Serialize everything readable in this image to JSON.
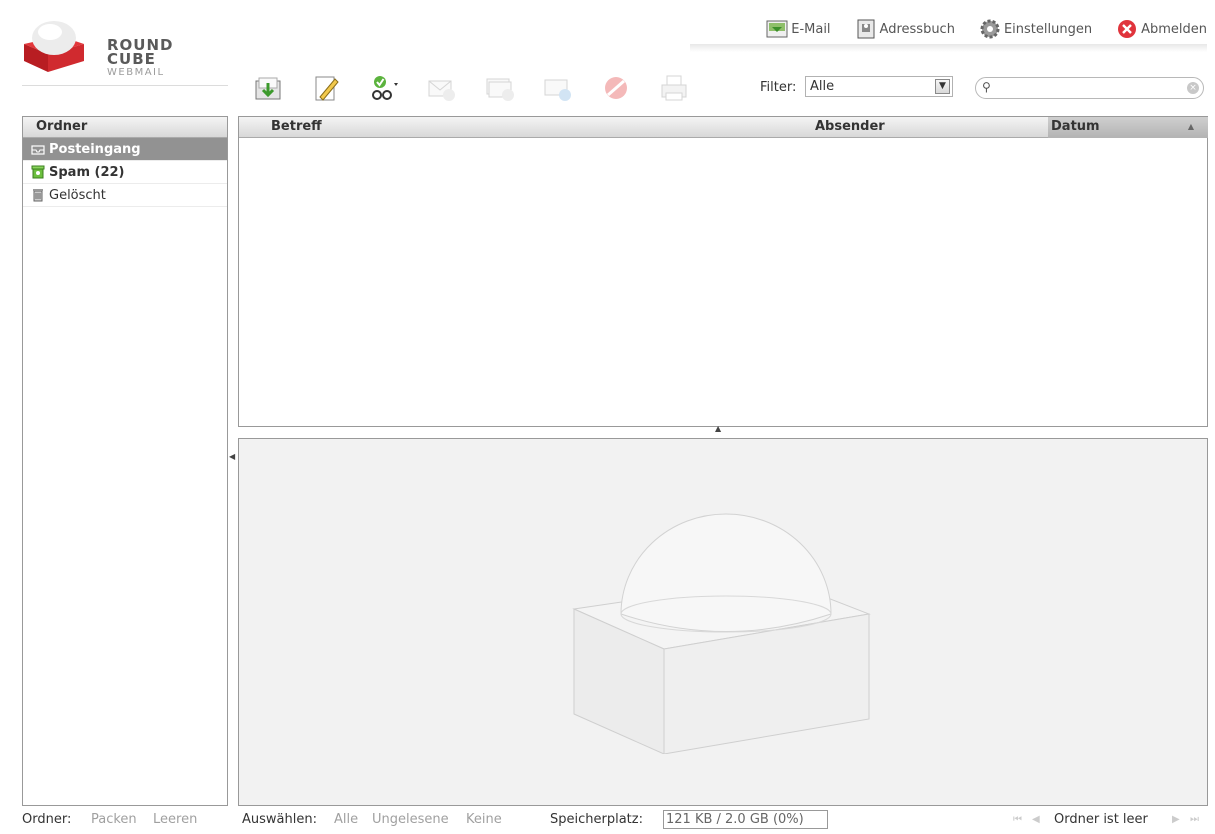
{
  "logo": {
    "line1": "ROUND",
    "line2": "CUBE",
    "line3": "WEBMAIL"
  },
  "taskbar": {
    "email": "E-Mail",
    "addressbook": "Adressbuch",
    "settings": "Einstellungen",
    "logout": "Abmelden"
  },
  "toolbar": {
    "buttons": [
      "checkmail-icon",
      "compose-icon",
      "markmessages-icon",
      "reply-icon",
      "reply-all-icon",
      "forward-icon",
      "delete-icon",
      "print-icon"
    ]
  },
  "filter": {
    "label": "Filter:",
    "selected": "Alle"
  },
  "search": {
    "placeholder": ""
  },
  "folders": {
    "title": "Ordner",
    "items": [
      {
        "label": "Posteingang",
        "state": "selected"
      },
      {
        "label": "Spam (22)",
        "state": "unread"
      },
      {
        "label": "Gelöscht",
        "state": "normal"
      }
    ]
  },
  "messagelist": {
    "col_subject": "Betreff",
    "col_from": "Absender",
    "col_date": "Datum"
  },
  "footer": {
    "folder_label": "Ordner:",
    "compact": "Packen",
    "empty": "Leeren",
    "select_label": "Auswählen:",
    "select_all": "Alle",
    "select_unread": "Ungelesene",
    "select_none": "Keine",
    "quota_label": "Speicherplatz:",
    "quota_value": "121 KB / 2.0 GB (0%)",
    "count": "Ordner ist leer"
  },
  "colors": {
    "accent": "#d8282e",
    "selected_row": "#929292"
  }
}
